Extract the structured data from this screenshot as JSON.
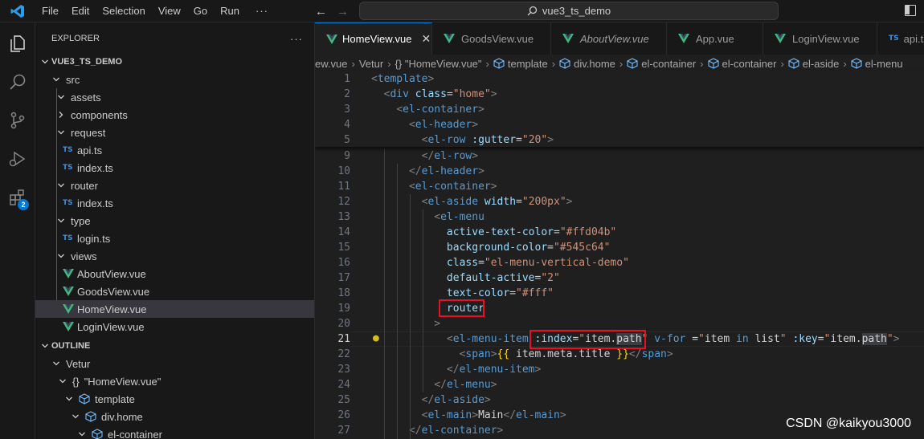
{
  "menubar": {
    "items": [
      "File",
      "Edit",
      "Selection",
      "View",
      "Go",
      "Run"
    ],
    "more": "···"
  },
  "command_center": {
    "text": "vue3_ts_demo"
  },
  "explorer": {
    "header": "EXPLORER",
    "more": "···",
    "project": "VUE3_TS_DEMO",
    "tree": [
      {
        "label": "src",
        "kind": "folder",
        "open": true
      },
      {
        "label": "assets",
        "kind": "folder",
        "open": true
      },
      {
        "label": "components",
        "kind": "folder",
        "open": false
      },
      {
        "label": "request",
        "kind": "folder",
        "open": true
      },
      {
        "label": "api.ts",
        "kind": "ts"
      },
      {
        "label": "index.ts",
        "kind": "ts"
      },
      {
        "label": "router",
        "kind": "folder",
        "open": true
      },
      {
        "label": "index.ts",
        "kind": "ts"
      },
      {
        "label": "type",
        "kind": "folder",
        "open": true
      },
      {
        "label": "login.ts",
        "kind": "ts"
      },
      {
        "label": "views",
        "kind": "folder",
        "open": true
      },
      {
        "label": "AboutView.vue",
        "kind": "vue"
      },
      {
        "label": "GoodsView.vue",
        "kind": "vue"
      },
      {
        "label": "HomeView.vue",
        "kind": "vue",
        "selected": true
      },
      {
        "label": "LoginView.vue",
        "kind": "vue"
      }
    ],
    "ts_badge": "TS"
  },
  "outline": {
    "header": "OUTLINE",
    "items": [
      {
        "label": "Vetur"
      },
      {
        "label": "\"HomeView.vue\"",
        "prefix": "{}"
      },
      {
        "label": "template"
      },
      {
        "label": "div.home"
      },
      {
        "label": "el-container"
      }
    ]
  },
  "activity": {
    "extensions_badge": "2"
  },
  "tabs": [
    {
      "label": "HomeView.vue",
      "active": true,
      "icon": "vue"
    },
    {
      "label": "GoodsView.vue",
      "icon": "vue"
    },
    {
      "label": "AboutView.vue",
      "icon": "vue",
      "italic": true
    },
    {
      "label": "App.vue",
      "icon": "vue"
    },
    {
      "label": "LoginView.vue",
      "icon": "vue"
    },
    {
      "label": "api.ts",
      "icon": "ts"
    }
  ],
  "breadcrumbs": [
    "ew.vue",
    "Vetur",
    "{} \"HomeView.vue\"",
    "template",
    "div.home",
    "el-container",
    "el-container",
    "el-aside",
    "el-menu"
  ],
  "code": {
    "sticky": [
      {
        "n": "1",
        "text": "<template>"
      },
      {
        "n": "2",
        "text": "  <div class=\"home\">"
      },
      {
        "n": "3",
        "text": "    <el-container>"
      },
      {
        "n": "4",
        "text": "      <el-header>"
      },
      {
        "n": "5",
        "text": "        <el-row :gutter=\"20\">"
      }
    ],
    "lines": [
      {
        "n": "9",
        "text": "        </el-row>"
      },
      {
        "n": "10",
        "text": "      </el-header>"
      },
      {
        "n": "11",
        "text": "      <el-container>"
      },
      {
        "n": "12",
        "text": "        <el-aside width=\"200px\">"
      },
      {
        "n": "13",
        "text": "          <el-menu"
      },
      {
        "n": "14",
        "text": "            active-text-color=\"#ffd04b\""
      },
      {
        "n": "15",
        "text": "            background-color=\"#545c64\""
      },
      {
        "n": "16",
        "text": "            class=\"el-menu-vertical-demo\""
      },
      {
        "n": "17",
        "text": "            default-active=\"2\""
      },
      {
        "n": "18",
        "text": "            text-color=\"#fff\""
      },
      {
        "n": "19",
        "text": "            router"
      },
      {
        "n": "20",
        "text": "          >"
      },
      {
        "n": "21",
        "text": "            <el-menu-item :index=\"item.path\" v-for =\"item in list\" :key=\"item.path\">"
      },
      {
        "n": "22",
        "text": "              <span>{{ item.meta.title }}</span>"
      },
      {
        "n": "23",
        "text": "            </el-menu-item>"
      },
      {
        "n": "24",
        "text": "          </el-menu>"
      },
      {
        "n": "25",
        "text": "        </el-aside>"
      },
      {
        "n": "26",
        "text": "        <el-main>Main</el-main>"
      },
      {
        "n": "27",
        "text": "      </el-container>"
      }
    ]
  },
  "watermark": "CSDN @kaikyou3000",
  "colors": {
    "accent": "#0078d4",
    "highlight_box": "#e81123",
    "ts": "#3b8eea",
    "vue": "#41b883"
  }
}
